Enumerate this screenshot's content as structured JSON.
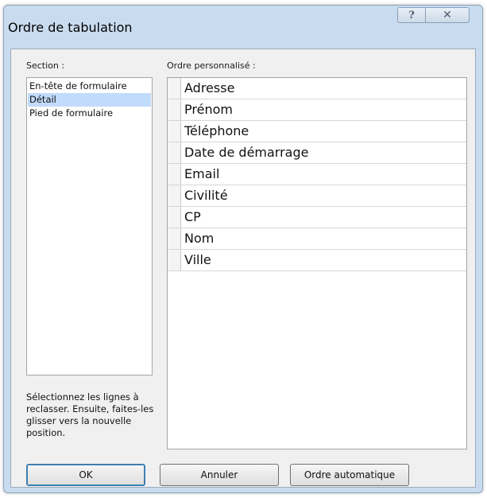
{
  "window": {
    "title": "Ordre de tabulation",
    "help_glyph": "?",
    "close_glyph": "✕"
  },
  "section": {
    "label": "Section :",
    "items": [
      {
        "label": "En-tête de formulaire",
        "selected": false
      },
      {
        "label": "Détail",
        "selected": true
      },
      {
        "label": "Pied de formulaire",
        "selected": false
      }
    ],
    "help_text": "Sélectionnez les lignes à reclasser. Ensuite, faites-les glisser vers la nouvelle position."
  },
  "custom_order": {
    "label": "Ordre personnalisé :",
    "rows": [
      "Adresse",
      "Prénom",
      "Téléphone",
      "Date de démarrage",
      "Email",
      "Civilité",
      "CP",
      "Nom",
      "Ville"
    ]
  },
  "buttons": {
    "ok": "OK",
    "cancel": "Annuler",
    "auto_order": "Ordre automatique"
  },
  "colors": {
    "frame": "#c9dcef",
    "client_bg": "#f0f0f0",
    "selection": "#c1dbfc"
  }
}
